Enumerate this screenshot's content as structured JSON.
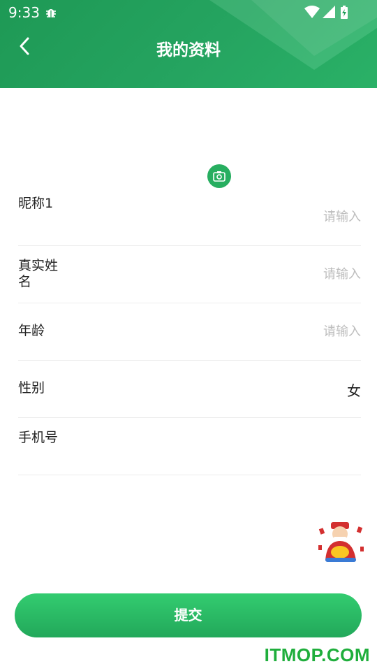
{
  "status_bar": {
    "time": "9:33"
  },
  "header": {
    "title": "我的资料"
  },
  "form": {
    "rows": [
      {
        "label": "昵称1",
        "value": "请输入",
        "is_placeholder": true
      },
      {
        "label": "真实姓名",
        "value": "请输入",
        "is_placeholder": true
      },
      {
        "label": "年龄",
        "value": "请输入",
        "is_placeholder": true
      },
      {
        "label": "性别",
        "value": "女",
        "is_placeholder": false
      },
      {
        "label": "手机号",
        "value": "",
        "is_placeholder": false
      }
    ]
  },
  "submit": {
    "label": "提交"
  },
  "watermark": "ITMOP.COM",
  "colors": {
    "brand_green": "#26a862",
    "button_green": "#2bbd66",
    "placeholder": "#bdbdbd"
  },
  "icons": [
    "back-icon",
    "camera-icon",
    "bug-icon",
    "wifi-icon",
    "signal-icon",
    "battery-icon",
    "mascot-icon"
  ]
}
